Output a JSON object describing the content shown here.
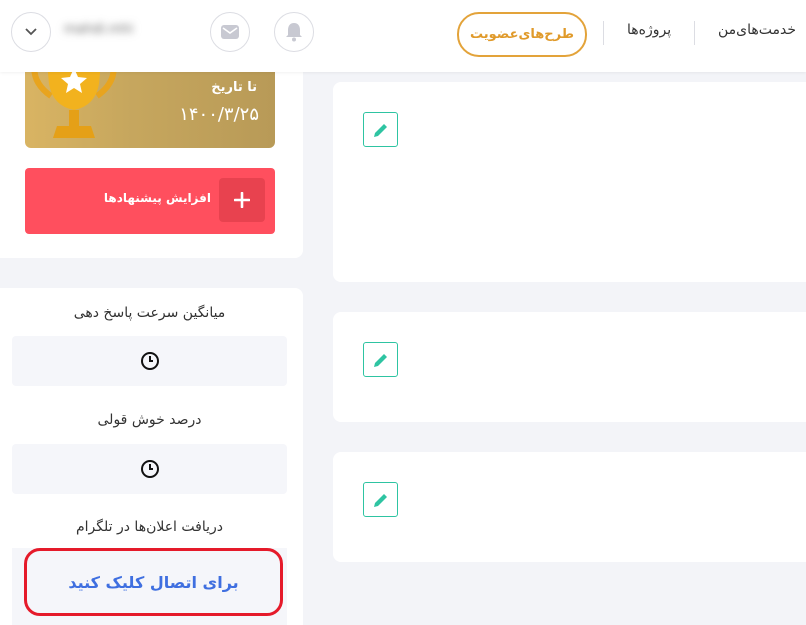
{
  "header": {
    "user_name": "mahdi.mhi",
    "nav_services": "خدمت‌های‌من",
    "nav_projects": "پروژه‌ها",
    "nav_plans": "طرح‌های‌عضویت"
  },
  "membership": {
    "until_label": "تا تاریخ",
    "date": "۱۴۰۰/۳/۲۵"
  },
  "increase_offers": {
    "label": "افزایش پیشنهادها"
  },
  "stats": {
    "response_speed_title": "میانگین سرعت پاسخ دهی",
    "reliability_title": "درصد خوش قولی",
    "telegram_title": "دریافت اعلان‌ها در تلگرام",
    "telegram_connect": "برای اتصال کلیک کنید"
  },
  "colors": {
    "accent_orange": "#e3a33a",
    "red_button": "#ff4f5e",
    "edit_green": "#2ec4a2",
    "link_blue": "#3f6fe0",
    "highlight_red": "#e51a2a"
  }
}
